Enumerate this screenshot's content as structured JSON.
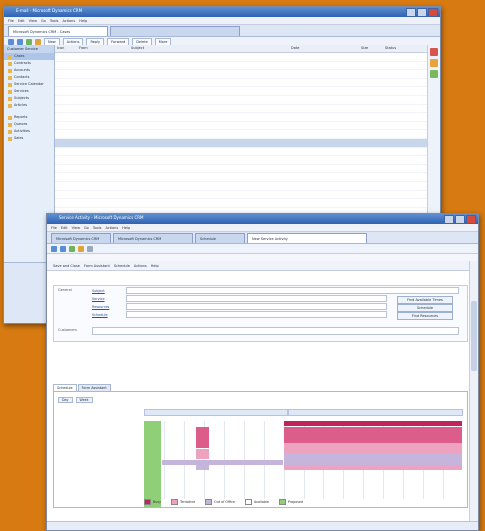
{
  "colors": {
    "background": "#d77a12",
    "block_dark": "#c2235b",
    "block_mid": "#dc5c8a",
    "block_light": "#eda3bf",
    "block_lilac": "#c5b5dd",
    "block_green": "#8fcf78"
  },
  "back_window": {
    "title": "E-mail - Microsoft Dynamics CRM",
    "menu": [
      "File",
      "Edit",
      "View",
      "Go",
      "Tools",
      "Actions",
      "Help"
    ],
    "tabs": [
      {
        "label": "Microsoft Dynamics CRM - Cases"
      },
      {
        "label": ""
      }
    ],
    "toolbar_buttons": [
      "New",
      "Actions",
      "Reply",
      "Forward",
      "Delete",
      "More"
    ],
    "nav_header": "Customer Service",
    "nav_items": [
      "Cases",
      "Contracts",
      "Accounts",
      "Contacts",
      "Service Calendar",
      "Services",
      "Subjects",
      "Articles",
      "Reports",
      "Queues",
      "Activities",
      "Sales"
    ],
    "grid_headers": [
      "Icon",
      "From",
      "Subject",
      "Date",
      "Size",
      "Status"
    ],
    "rows": [
      {
        "c1": "",
        "c2": "",
        "c3": "",
        "c4": "",
        "c5": "",
        "c6": "",
        "style": "dim"
      },
      {
        "c1": "",
        "c2": "",
        "c3": "",
        "c4": "",
        "c5": "",
        "c6": "",
        "style": "dim"
      },
      {
        "c1": "",
        "c2": "",
        "c3": "",
        "c4": "",
        "c5": "",
        "c6": "",
        "style": "dim"
      },
      {
        "c1": "",
        "c2": "",
        "c3": "",
        "c4": "",
        "c5": "",
        "c6": "",
        "style": "dim"
      },
      {
        "c1": "",
        "c2": "",
        "c3": "",
        "c4": "",
        "c5": "",
        "c6": "",
        "style": "dim"
      },
      {
        "c1": "",
        "c2": "",
        "c3": "",
        "c4": "",
        "c5": "",
        "c6": "",
        "style": "dim"
      },
      {
        "c1": "",
        "c2": "",
        "c3": "",
        "c4": "",
        "c5": "",
        "c6": "",
        "style": "dim"
      },
      {
        "c1": "",
        "c2": "",
        "c3": "",
        "c4": "",
        "c5": "",
        "c6": "",
        "style": "sub"
      },
      {
        "c1": "",
        "c2": "",
        "c3": "",
        "c4": "",
        "c5": "",
        "c6": "",
        "style": "dim"
      },
      {
        "c1": "",
        "c2": "",
        "c3": "",
        "c4": "",
        "c5": "",
        "c6": "",
        "style": "dim"
      },
      {
        "c1": "",
        "c2": "",
        "c3": "",
        "c4": "",
        "c5": "",
        "c6": "",
        "style": "hl"
      },
      {
        "c1": "",
        "c2": "",
        "c3": "",
        "c4": "",
        "c5": "",
        "c6": "",
        "style": "bold"
      },
      {
        "c1": "",
        "c2": "",
        "c3": "",
        "c4": "",
        "c5": "",
        "c6": "",
        "style": "dim"
      },
      {
        "c1": "",
        "c2": "",
        "c3": "",
        "c4": "",
        "c5": "",
        "c6": "",
        "style": "dim"
      },
      {
        "c1": "",
        "c2": "",
        "c3": "",
        "c4": "",
        "c5": "",
        "c6": "",
        "style": "dim"
      },
      {
        "c1": "",
        "c2": "",
        "c3": "",
        "c4": "",
        "c5": "",
        "c6": "",
        "style": "dim"
      },
      {
        "c1": "",
        "c2": "",
        "c3": "",
        "c4": "",
        "c5": "",
        "c6": "",
        "style": "dim"
      },
      {
        "c1": "",
        "c2": "",
        "c3": "",
        "c4": "",
        "c5": "",
        "c6": "",
        "style": "dim"
      },
      {
        "c1": "",
        "c2": "",
        "c3": "",
        "c4": "",
        "c5": "",
        "c6": "",
        "style": "dim"
      }
    ]
  },
  "front_window": {
    "title": "Service Activity - Microsoft Dynamics CRM",
    "menu": [
      "File",
      "Edit",
      "View",
      "Go",
      "Tools",
      "Actions",
      "Help"
    ],
    "tabs": [
      {
        "label": "Microsoft Dynamics CRM"
      },
      {
        "label": "Microsoft Dynamics CRM"
      },
      {
        "label": "Schedule"
      },
      {
        "label": "New Service Activity"
      }
    ],
    "toolbar_buttons": [
      "Save and Close",
      "Form Assistant",
      "Schedule",
      "Actions",
      "Help"
    ],
    "form": {
      "section_label": "General",
      "fields": [
        {
          "label": "Subject",
          "value": ""
        },
        {
          "label": "Service",
          "value": ""
        },
        {
          "label": "Resources",
          "value": ""
        },
        {
          "label": "Schedule",
          "value": ""
        }
      ],
      "buttons": [
        "Find Available Times",
        "Schedule",
        "Find Resources"
      ],
      "customer_label": "Customers"
    },
    "inner_tabs": [
      "Schedule",
      "Form Assistant"
    ],
    "schedule": {
      "hint": "",
      "toolbar": [
        "Day",
        "Week"
      ],
      "dates": [
        "",
        ""
      ],
      "hours": [
        "",
        "",
        "",
        "",
        "",
        "",
        "",
        "",
        "",
        "",
        "",
        "",
        "",
        "",
        "",
        ""
      ],
      "legend": [
        "Busy",
        "Tentative",
        "Out of Office",
        "Available",
        "Proposed"
      ]
    },
    "status": ""
  }
}
